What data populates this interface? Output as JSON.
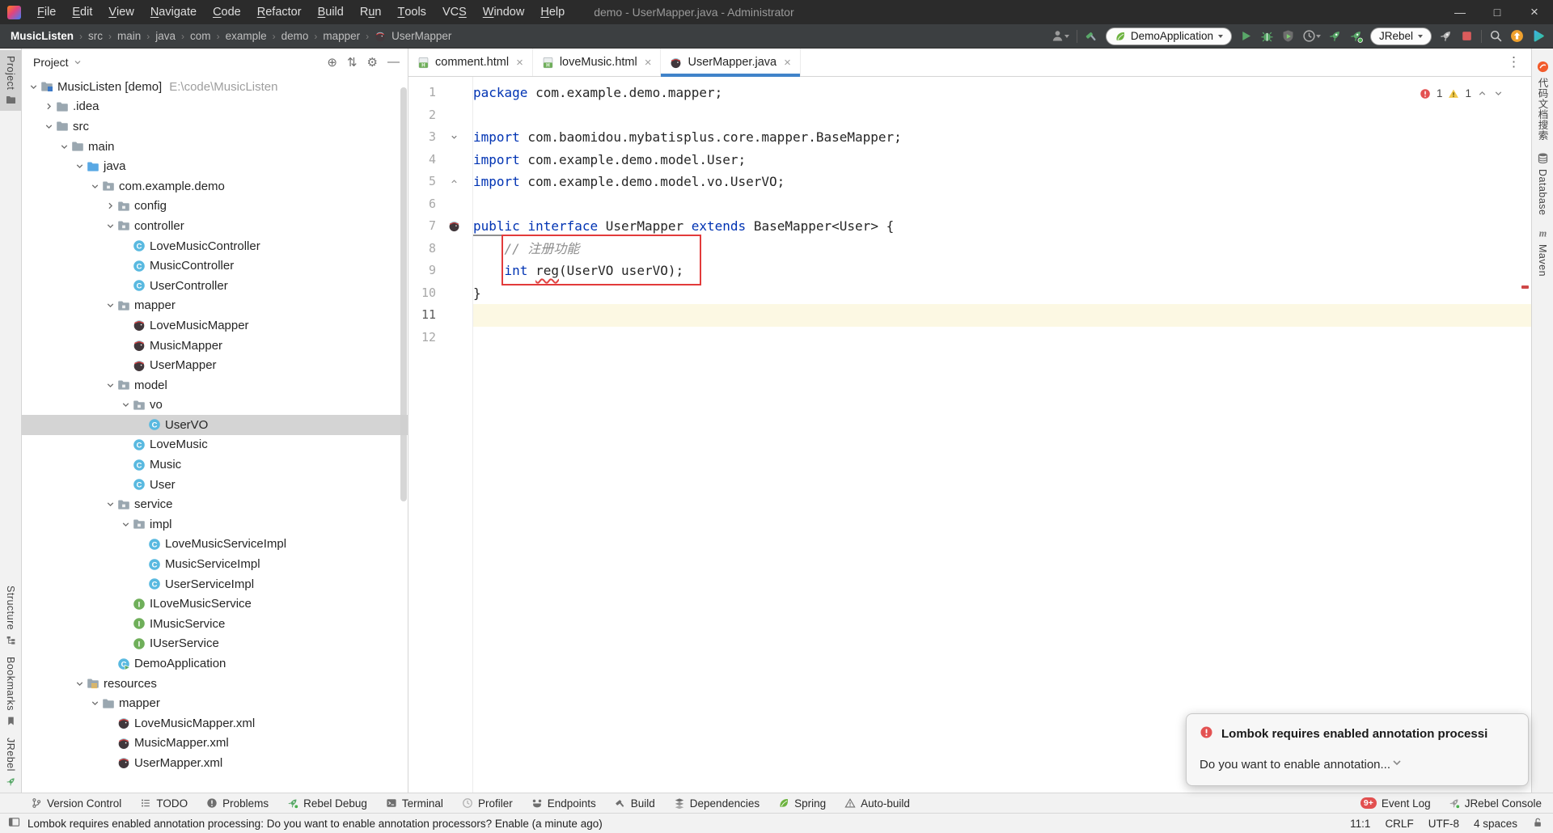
{
  "window": {
    "title": "demo - UserMapper.java - Administrator",
    "menu": [
      {
        "label": "File",
        "mn": 0
      },
      {
        "label": "Edit",
        "mn": 0
      },
      {
        "label": "View",
        "mn": 0
      },
      {
        "label": "Navigate",
        "mn": 0
      },
      {
        "label": "Code",
        "mn": 0
      },
      {
        "label": "Refactor",
        "mn": 0
      },
      {
        "label": "Build",
        "mn": 0
      },
      {
        "label": "Run",
        "mn": 1
      },
      {
        "label": "Tools",
        "mn": 0
      },
      {
        "label": "VCS",
        "mn": 2
      },
      {
        "label": "Window",
        "mn": 0
      },
      {
        "label": "Help",
        "mn": 0
      }
    ],
    "controls": {
      "minimize": "—",
      "maximize": "□",
      "close": "×"
    }
  },
  "navbar": {
    "breadcrumbs": [
      "MusicListen",
      "src",
      "main",
      "java",
      "com",
      "example",
      "demo",
      "mapper",
      "UserMapper"
    ],
    "toolbar_items": [
      {
        "type": "icon",
        "name": "user-profile",
        "arrow": true
      },
      {
        "type": "sep"
      },
      {
        "type": "icon",
        "name": "build-hammer"
      },
      {
        "type": "button",
        "label": "DemoApplication",
        "icon": "spring-leaf"
      },
      {
        "type": "icon",
        "name": "run-play"
      },
      {
        "type": "icon",
        "name": "debug-bug"
      },
      {
        "type": "icon",
        "name": "run-coverage"
      },
      {
        "type": "icon",
        "name": "profiler-clock",
        "arrow": true
      },
      {
        "type": "icon",
        "name": "jrebel-run-rocket"
      },
      {
        "type": "icon",
        "name": "jrebel-debug-rocket"
      },
      {
        "type": "button",
        "label": "JRebel"
      },
      {
        "type": "icon",
        "name": "jrebel-disabled-rocket"
      },
      {
        "type": "icon",
        "name": "stop"
      },
      {
        "type": "sep"
      },
      {
        "type": "icon",
        "name": "search"
      },
      {
        "type": "icon",
        "name": "ide-update"
      },
      {
        "type": "icon",
        "name": "teal-play-logo"
      }
    ]
  },
  "left_stripe": {
    "top": [
      {
        "label": "Project",
        "icon": "project-folder",
        "active": true
      }
    ],
    "bottom": [
      {
        "label": "Structure",
        "icon": "structure"
      },
      {
        "label": "Bookmarks",
        "icon": "bookmarks"
      },
      {
        "label": "JRebel",
        "icon": "jrebel-run-rocket"
      }
    ]
  },
  "right_stripe": {
    "items": [
      {
        "label": "代码文档搜索",
        "icon": "cn-plugin"
      },
      {
        "label": "Database",
        "icon": "database"
      },
      {
        "label": "Maven",
        "icon": "maven-m"
      }
    ]
  },
  "project_panel": {
    "header_label": "Project",
    "header_icons": [
      "locate-file",
      "expand-collapse",
      "settings-gear",
      "hide-panel"
    ],
    "tree": [
      {
        "l": 0,
        "label": "MusicListen [demo]",
        "hint": "E:\\code\\MusicListen",
        "icon": "folder-project",
        "ch": "open"
      },
      {
        "l": 1,
        "label": ".idea",
        "icon": "folder",
        "ch": "closed"
      },
      {
        "l": 1,
        "label": "src",
        "icon": "folder",
        "ch": "open"
      },
      {
        "l": 2,
        "label": "main",
        "icon": "folder",
        "ch": "open"
      },
      {
        "l": 3,
        "label": "java",
        "icon": "folder-src",
        "ch": "open"
      },
      {
        "l": 4,
        "label": "com.example.demo",
        "icon": "package",
        "ch": "open"
      },
      {
        "l": 5,
        "label": "config",
        "icon": "package",
        "ch": "closed"
      },
      {
        "l": 5,
        "label": "controller",
        "icon": "package",
        "ch": "open"
      },
      {
        "l": 6,
        "label": "LoveMusicController",
        "icon": "class"
      },
      {
        "l": 6,
        "label": "MusicController",
        "icon": "class"
      },
      {
        "l": 6,
        "label": "UserController",
        "icon": "class"
      },
      {
        "l": 5,
        "label": "mapper",
        "icon": "package",
        "ch": "open"
      },
      {
        "l": 6,
        "label": "LoveMusicMapper",
        "icon": "mybatis"
      },
      {
        "l": 6,
        "label": "MusicMapper",
        "icon": "mybatis"
      },
      {
        "l": 6,
        "label": "UserMapper",
        "icon": "mybatis"
      },
      {
        "l": 5,
        "label": "model",
        "icon": "package",
        "ch": "open"
      },
      {
        "l": 6,
        "label": "vo",
        "icon": "package",
        "ch": "open"
      },
      {
        "l": 7,
        "label": "UserVO",
        "icon": "class",
        "selected": true
      },
      {
        "l": 6,
        "label": "LoveMusic",
        "icon": "class"
      },
      {
        "l": 6,
        "label": "Music",
        "icon": "class"
      },
      {
        "l": 6,
        "label": "User",
        "icon": "class"
      },
      {
        "l": 5,
        "label": "service",
        "icon": "package",
        "ch": "open"
      },
      {
        "l": 6,
        "label": "impl",
        "icon": "package",
        "ch": "open"
      },
      {
        "l": 7,
        "label": "LoveMusicServiceImpl",
        "icon": "class"
      },
      {
        "l": 7,
        "label": "MusicServiceImpl",
        "icon": "class"
      },
      {
        "l": 7,
        "label": "UserServiceImpl",
        "icon": "class"
      },
      {
        "l": 6,
        "label": "ILoveMusicService",
        "icon": "interface"
      },
      {
        "l": 6,
        "label": "IMusicService",
        "icon": "interface"
      },
      {
        "l": 6,
        "label": "IUserService",
        "icon": "interface"
      },
      {
        "l": 5,
        "label": "DemoApplication",
        "icon": "class-run"
      },
      {
        "l": 3,
        "label": "resources",
        "icon": "folder-res",
        "ch": "open"
      },
      {
        "l": 4,
        "label": "mapper",
        "icon": "folder",
        "ch": "open"
      },
      {
        "l": 5,
        "label": "LoveMusicMapper.xml",
        "icon": "mybatis"
      },
      {
        "l": 5,
        "label": "MusicMapper.xml",
        "icon": "mybatis"
      },
      {
        "l": 5,
        "label": "UserMapper.xml",
        "icon": "mybatis"
      }
    ]
  },
  "tabs": [
    {
      "label": "comment.html",
      "icon": "html-file"
    },
    {
      "label": "loveMusic.html",
      "icon": "html-file"
    },
    {
      "label": "UserMapper.java",
      "icon": "mybatis",
      "active": true
    }
  ],
  "editor": {
    "inspections": {
      "errors": "1",
      "warnings": "1"
    },
    "lines": [
      {
        "n": "1",
        "segs": [
          [
            "kw",
            "package"
          ],
          [
            "",
            " com.example.demo.mapper;"
          ]
        ]
      },
      {
        "n": "2",
        "segs": []
      },
      {
        "n": "3",
        "fold": "down",
        "segs": [
          [
            "kw",
            "import"
          ],
          [
            "",
            " com.baomidou.mybatisplus.core.mapper.BaseMapper;"
          ]
        ]
      },
      {
        "n": "4",
        "segs": [
          [
            "kw",
            "import"
          ],
          [
            "",
            " com.example.demo.model.User;"
          ]
        ]
      },
      {
        "n": "5",
        "fold": "up",
        "segs": [
          [
            "kw",
            "import"
          ],
          [
            "",
            " com.example.demo.model.vo.UserVO;"
          ]
        ]
      },
      {
        "n": "6",
        "segs": []
      },
      {
        "n": "7",
        "gicon": "mybatis",
        "segs": [
          [
            "kw u",
            "public"
          ],
          [
            "u",
            " "
          ],
          [
            "kw u",
            "interface"
          ],
          [
            "u",
            " "
          ],
          [
            "u",
            "UserMapper"
          ],
          [
            "",
            " "
          ],
          [
            "kw",
            "extends"
          ],
          [
            "",
            " BaseMapper<User> {"
          ]
        ]
      },
      {
        "n": "8",
        "segs": [
          [
            "",
            "    "
          ],
          [
            "cm",
            "// 注册功能"
          ]
        ]
      },
      {
        "n": "9",
        "segs": [
          [
            "",
            "    "
          ],
          [
            "kw",
            "int"
          ],
          [
            "",
            " "
          ],
          [
            "sq",
            "reg"
          ],
          [
            "",
            "(UserVO userVO);"
          ]
        ]
      },
      {
        "n": "10",
        "segs": [
          [
            "",
            "}"
          ]
        ]
      },
      {
        "n": "11",
        "current": true,
        "segs": []
      },
      {
        "n": "12",
        "segs": []
      }
    ]
  },
  "tool_window_bar": {
    "left": [
      {
        "label": "Version Control",
        "icon": "vcs-branch"
      },
      {
        "label": "TODO",
        "icon": "todo-list"
      },
      {
        "label": "Problems",
        "icon": "problems"
      },
      {
        "label": "Rebel Debug",
        "icon": "jrebel-debug-rocket"
      },
      {
        "label": "Terminal",
        "icon": "terminal"
      },
      {
        "label": "Profiler",
        "icon": "profiler-clock"
      },
      {
        "label": "Endpoints",
        "icon": "endpoints"
      },
      {
        "label": "Build",
        "icon": "build-hammer-gray"
      },
      {
        "label": "Dependencies",
        "icon": "dependencies"
      },
      {
        "label": "Spring",
        "icon": "spring-leaf"
      },
      {
        "label": "Auto-build",
        "icon": "autobuild-warning"
      }
    ],
    "right": [
      {
        "label": "Event Log",
        "badge": "9+"
      },
      {
        "label": "JRebel Console",
        "icon": "jrebel-console"
      }
    ]
  },
  "status_bar": {
    "message": "Lombok requires enabled annotation processing: Do you want to enable annotation processors? Enable (a minute ago)",
    "caret": "11:1",
    "line_ending": "CRLF",
    "encoding": "UTF-8",
    "indent": "4 spaces"
  },
  "notification": {
    "title": "Lombok requires enabled annotation processi",
    "body": "Do you want to enable annotation..."
  },
  "colors": {
    "accent_tab": "#4083c9",
    "keyword": "#0033b3",
    "error_red": "#e35252",
    "warning_yellow": "#f2c94c",
    "run_green": "#59a869",
    "annotation_red": "#e23b3b",
    "current_line": "#fcf8e3"
  }
}
